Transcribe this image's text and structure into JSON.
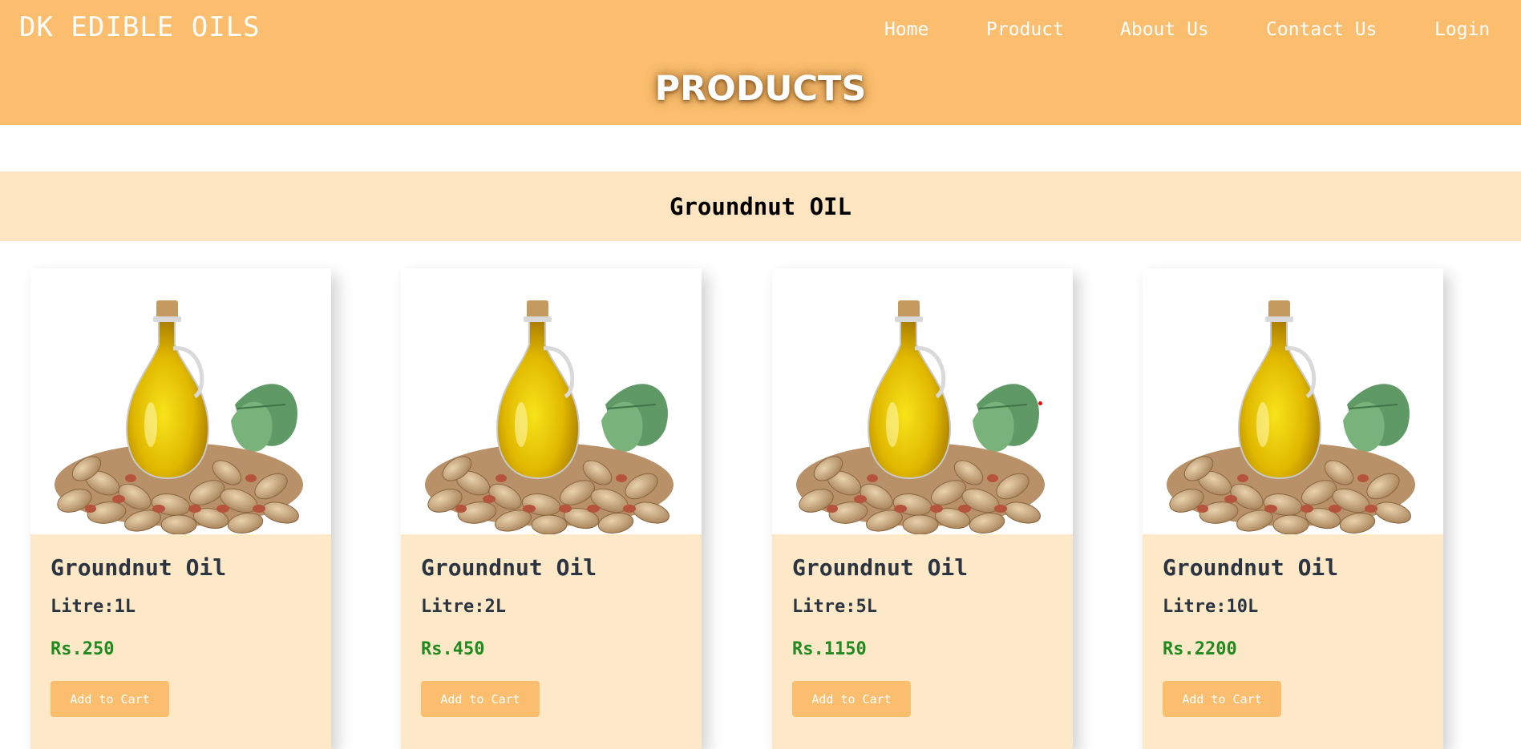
{
  "brand": {
    "name": "DK EDIBLE OILS",
    "accent_color": "#fabe6e"
  },
  "nav": {
    "items": [
      {
        "label": "Home"
      },
      {
        "label": "Product"
      },
      {
        "label": "About Us"
      },
      {
        "label": "Contact Us"
      },
      {
        "label": "Login"
      }
    ]
  },
  "page": {
    "heading": "PRODUCTS"
  },
  "section": {
    "title": "Groundnut OIL"
  },
  "products": [
    {
      "name": "Groundnut Oil",
      "litre": "Litre:1L",
      "price": "Rs.250",
      "cta": "Add to Cart",
      "image_icon": "groundnut-oil-bottle-icon"
    },
    {
      "name": "Groundnut Oil",
      "litre": "Litre:2L",
      "price": "Rs.450",
      "cta": "Add to Cart",
      "image_icon": "groundnut-oil-bottle-icon"
    },
    {
      "name": "Groundnut Oil",
      "litre": "Litre:5L",
      "price": "Rs.1150",
      "cta": "Add to Cart",
      "image_icon": "groundnut-oil-bottle-icon"
    },
    {
      "name": "Groundnut Oil",
      "litre": "Litre:10L",
      "price": "Rs.2200",
      "cta": "Add to Cart",
      "image_icon": "groundnut-oil-bottle-icon"
    }
  ]
}
